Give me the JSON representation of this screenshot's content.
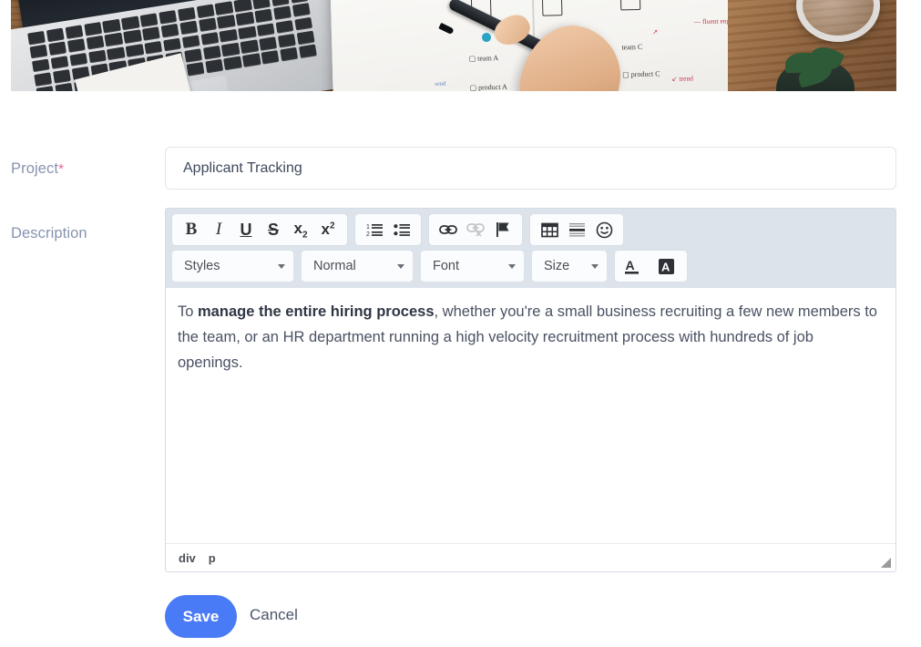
{
  "banner": {
    "alt": "Person writing product planning diagrams in a notebook beside a laptop on a wooden desk"
  },
  "form": {
    "project": {
      "label": "Project",
      "required_mark": "*",
      "value": "Applicant Tracking",
      "placeholder": ""
    },
    "description": {
      "label": "Description",
      "content_plain": "To manage the entire hiring process, whether you're a small business recruiting a few new members to the team, or an HR department running a high velocity recruitment process with hundreds of job openings.",
      "content_prefix": "To ",
      "content_bold": "manage the entire hiring process",
      "content_rest": ", whether you're a small business recruiting a few new members to the team, or an HR department running a high velocity recruitment process with hundreds of job openings."
    }
  },
  "editor": {
    "toolbar_row1": [
      {
        "name": "bold-icon",
        "glyph": "B",
        "label": "Bold",
        "disabled": false
      },
      {
        "name": "italic-icon",
        "glyph": "I",
        "label": "Italic",
        "disabled": false
      },
      {
        "name": "underline-icon",
        "glyph": "U",
        "label": "Underline",
        "disabled": false
      },
      {
        "name": "strikethrough-icon",
        "glyph": "S",
        "label": "Strikethrough",
        "disabled": false
      },
      {
        "name": "subscript-icon",
        "glyph": "x",
        "sub": "2",
        "label": "Subscript",
        "disabled": false
      },
      {
        "name": "superscript-icon",
        "glyph": "x",
        "sup": "2",
        "label": "Superscript",
        "disabled": false
      },
      {
        "name": "numbered-list-icon",
        "label": "Insert/Remove Numbered List",
        "disabled": false
      },
      {
        "name": "bulleted-list-icon",
        "label": "Insert/Remove Bulleted List",
        "disabled": false
      },
      {
        "name": "link-icon",
        "label": "Link",
        "disabled": false
      },
      {
        "name": "unlink-icon",
        "label": "Unlink",
        "disabled": true
      },
      {
        "name": "anchor-flag-icon",
        "label": "Anchor",
        "disabled": false
      },
      {
        "name": "table-icon",
        "label": "Table",
        "disabled": false
      },
      {
        "name": "horizontal-rule-icon",
        "label": "Horizontal Line",
        "disabled": false
      },
      {
        "name": "smiley-icon",
        "label": "Smiley",
        "disabled": false
      }
    ],
    "dropdowns": [
      {
        "name": "styles-select",
        "value": "Styles"
      },
      {
        "name": "paragraph-format-select",
        "value": "Normal"
      },
      {
        "name": "font-select",
        "value": "Font"
      },
      {
        "name": "size-select",
        "value": "Size"
      }
    ],
    "color_buttons": [
      {
        "name": "text-color-button",
        "glyph": "A",
        "label": "Text Color"
      },
      {
        "name": "background-color-button",
        "glyph": "A",
        "label": "Background Color"
      }
    ],
    "statusbar": {
      "path": [
        "div",
        "p"
      ]
    }
  },
  "actions": {
    "save_label": "Save",
    "cancel_label": "Cancel"
  },
  "colors": {
    "accent": "#4a7bf7",
    "label": "#8793b0",
    "required": "#f06292",
    "toolbar_bg": "#dde3ea",
    "body_text": "#4a5163",
    "editor_border": "#d4dbe4",
    "input_border": "#e3e6ed"
  }
}
